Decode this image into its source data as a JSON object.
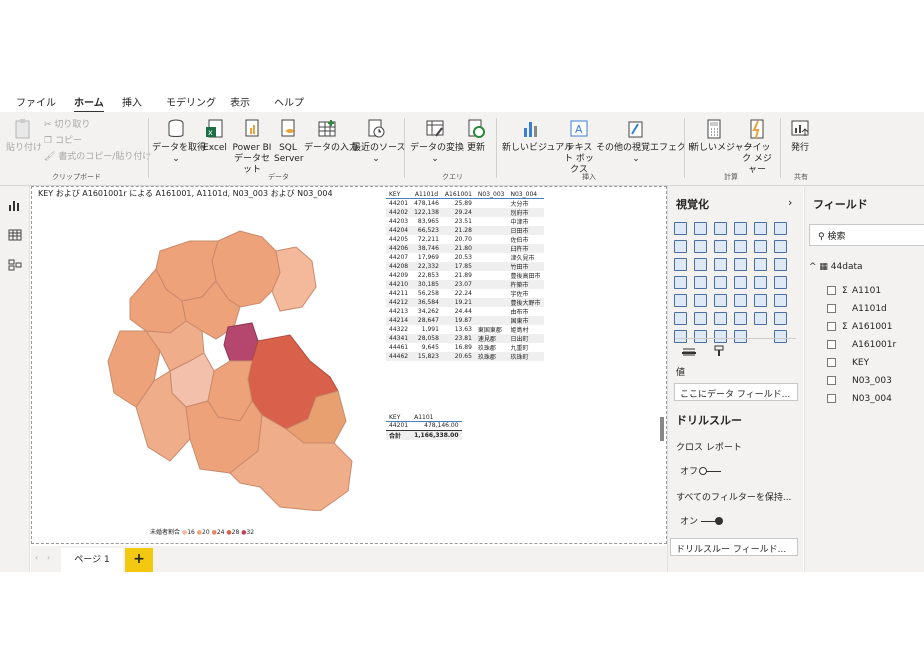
{
  "menu": {
    "tabs": [
      "ファイル",
      "ホーム",
      "挿入",
      "モデリング",
      "表示",
      "ヘルプ"
    ],
    "active": "ホーム"
  },
  "ribbon": {
    "clipboard": {
      "paste": "貼り付け",
      "cut": "切り取り",
      "copy": "コピー",
      "format_copy": "書式のコピー/貼り付け",
      "group": "クリップボード"
    },
    "data": {
      "get_data": "データを取得",
      "excel": "Excel",
      "powerbi": "Power BI データセット",
      "sql": "SQL Server",
      "enter_data": "データの入力",
      "recent": "最近のソース",
      "group": "データ"
    },
    "query": {
      "transform": "データの変換",
      "refresh": "更新",
      "group": "クエリ"
    },
    "insert": {
      "new_visual": "新しいビジュアル",
      "textbox": "テキスト ボックス",
      "more_visuals": "その他の視覚エフェクト",
      "group": "挿入"
    },
    "calc": {
      "new_measure": "新しいメジャー",
      "quick_measure": "クイック メジャー",
      "group": "計算"
    },
    "share": {
      "publish": "発行",
      "group": "共有"
    }
  },
  "map_title": "KEY および A1601001r による A161001, A1101d, N03_003 および N03_004",
  "legend": {
    "label": "未婚者割合",
    "items": [
      "16",
      "20",
      "24",
      "28",
      "32"
    ],
    "colors": [
      "#f4b89a",
      "#eda27a",
      "#e4875f",
      "#d9604a",
      "#c0405a"
    ]
  },
  "table1": {
    "headers": [
      "KEY",
      "A1101d",
      "A161001",
      "N03_003",
      "N03_004"
    ],
    "rows": [
      [
        "44201",
        "478,146",
        "25.89",
        "",
        "大分市"
      ],
      [
        "44202",
        "122,138",
        "29.24",
        "",
        "別府市"
      ],
      [
        "44203",
        "83,965",
        "23.51",
        "",
        "中津市"
      ],
      [
        "44204",
        "66,523",
        "21.28",
        "",
        "日田市"
      ],
      [
        "44205",
        "72,211",
        "20.70",
        "",
        "佐伯市"
      ],
      [
        "44206",
        "38,746",
        "21.80",
        "",
        "臼杵市"
      ],
      [
        "44207",
        "17,969",
        "20.53",
        "",
        "津久見市"
      ],
      [
        "44208",
        "22,332",
        "17.85",
        "",
        "竹田市"
      ],
      [
        "44209",
        "22,853",
        "21.89",
        "",
        "豊後高田市"
      ],
      [
        "44210",
        "30,185",
        "23.07",
        "",
        "杵築市"
      ],
      [
        "44211",
        "56,258",
        "22.24",
        "",
        "宇佐市"
      ],
      [
        "44212",
        "36,584",
        "19.21",
        "",
        "豊後大野市"
      ],
      [
        "44213",
        "34,262",
        "24.44",
        "",
        "由布市"
      ],
      [
        "44214",
        "28,647",
        "19.87",
        "",
        "国東市"
      ],
      [
        "44322",
        "1,991",
        "13.63",
        "東国東郡",
        "姫島村"
      ],
      [
        "44341",
        "28,058",
        "23.81",
        "速見郡",
        "日出町"
      ],
      [
        "44461",
        "9,645",
        "16.89",
        "玖珠郡",
        "九重町"
      ],
      [
        "44462",
        "15,823",
        "20.65",
        "玖珠郡",
        "玖珠町"
      ]
    ]
  },
  "table2": {
    "headers": [
      "KEY",
      "A1101"
    ],
    "rows": [
      [
        "44201",
        "478,146.00"
      ]
    ],
    "total_label": "合計",
    "total_value": "1,166,338.00"
  },
  "pages": {
    "page1": "ページ 1",
    "add": "+"
  },
  "viz": {
    "title": "視覚化",
    "values": "値",
    "drop_field": "ここにデータ フィールド...",
    "drill_title": "ドリルスルー",
    "cross_report": "クロス レポート",
    "off": "オフ",
    "keep_all": "すべてのフィルターを保持...",
    "on": "オン",
    "drill_field": "ドリルスルー フィールド..."
  },
  "fields": {
    "title": "フィールド",
    "search_placeholder": "検索",
    "table": "44data",
    "items": [
      {
        "label": "A1101",
        "sigma": "Σ"
      },
      {
        "label": "A1101d",
        "sigma": ""
      },
      {
        "label": "A161001",
        "sigma": "Σ"
      },
      {
        "label": "A161001r",
        "sigma": ""
      },
      {
        "label": "KEY",
        "sigma": ""
      },
      {
        "label": "N03_003",
        "sigma": ""
      },
      {
        "label": "N03_004",
        "sigma": ""
      }
    ]
  }
}
